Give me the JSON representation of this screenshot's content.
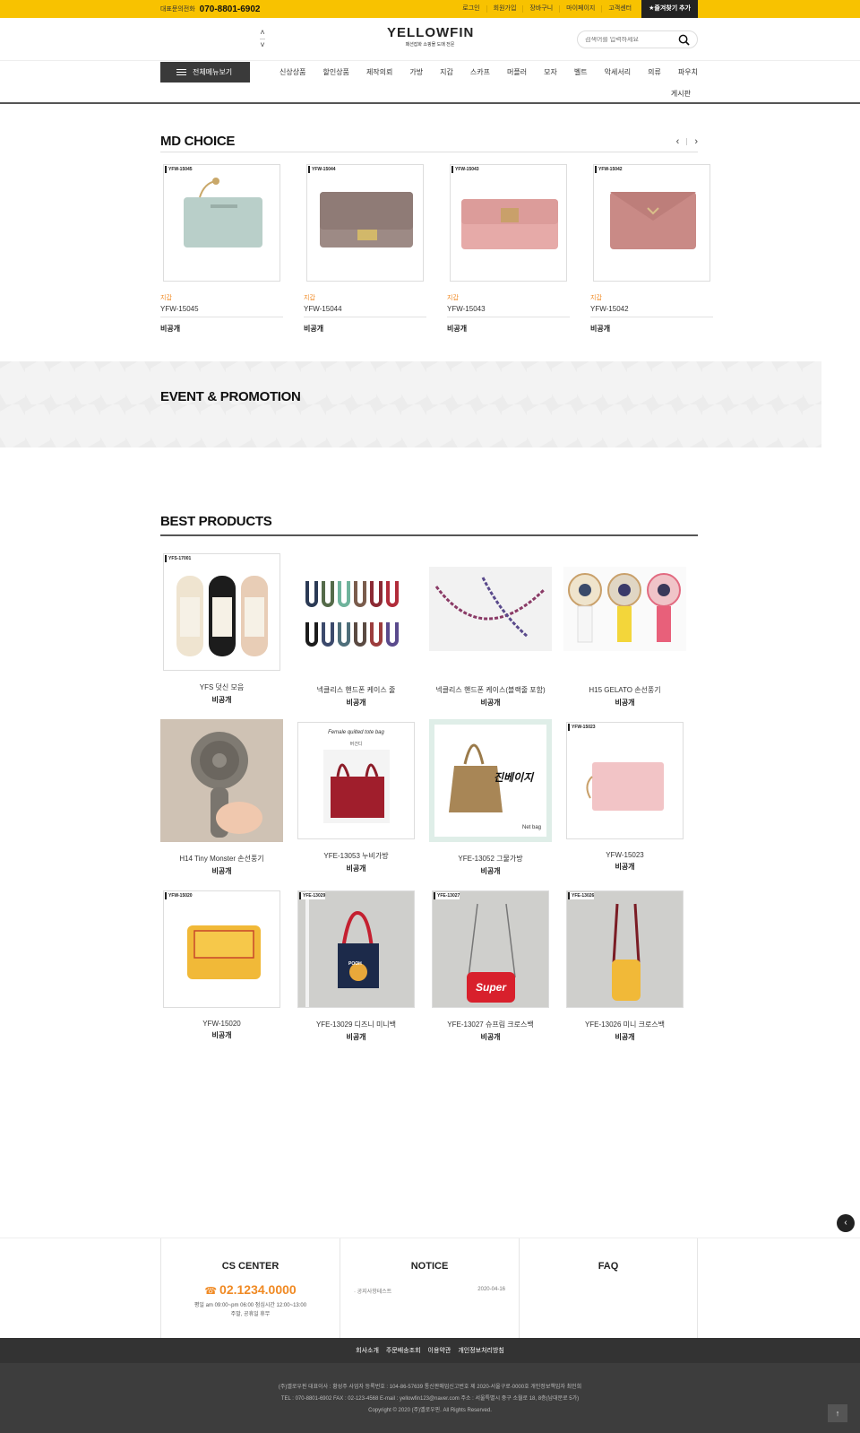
{
  "topbar": {
    "phone_label": "대표문의전화",
    "phone": "070-8801-6902",
    "links": [
      "로그인",
      "회원가입",
      "장바구니",
      "마이페이지",
      "고객센터"
    ],
    "favorite": "★즐겨찾기 추가"
  },
  "header": {
    "logo": "YELLOWFIN",
    "logo_sub": "패션잡화 쇼핑몰 도매 전문",
    "search_placeholder": "검색어를 입력하세요"
  },
  "nav": {
    "all_menu": "전체메뉴보기",
    "items": [
      "신상상품",
      "할인상품",
      "제작의뢰",
      "가방",
      "지갑",
      "스카프",
      "머플러",
      "모자",
      "벨트",
      "악세서리",
      "의류",
      "파우치"
    ],
    "board": "게시판"
  },
  "md_choice": {
    "title": "MD CHOICE",
    "items": [
      {
        "tag": "YFW-15045",
        "category": "지갑",
        "name": "YFW-15045",
        "price": "비공개",
        "color": "#b9cfc9"
      },
      {
        "tag": "YFW-15044",
        "category": "지갑",
        "name": "YFW-15044",
        "price": "비공개",
        "color": "#9d8a85"
      },
      {
        "tag": "YFW-15043",
        "category": "지갑",
        "name": "YFW-15043",
        "price": "비공개",
        "color": "#e6aaa8"
      },
      {
        "tag": "YFW-15042",
        "category": "지갑",
        "name": "YFW-15042",
        "price": "비공개",
        "color": "#c98a86"
      }
    ]
  },
  "event": {
    "title": "EVENT & PROMOTION"
  },
  "best": {
    "title": "BEST PRODUCTS",
    "items": [
      {
        "tag": "YFS-17001",
        "name": "YFS 덧신 모음",
        "price": "비공개"
      },
      {
        "tag": "",
        "name": "넥클리스 핸드폰 케이스 줄",
        "price": "비공개"
      },
      {
        "tag": "",
        "name": "넥클리스 핸드폰 케이스(블랙줄 포함)",
        "price": "비공개"
      },
      {
        "tag": "",
        "name": "H15 GELATO 손선풍기",
        "price": "비공개"
      },
      {
        "tag": "",
        "name": "H14 Tiny Monster 손선풍기",
        "price": "비공개"
      },
      {
        "tag": "",
        "name": "YFE-13053 누비가방",
        "price": "비공개",
        "img_text": "Female quilted tote bag",
        "img_sub": "버건디"
      },
      {
        "tag": "",
        "name": "YFE-13052 그물가방",
        "price": "비공개",
        "img_text": "진베이지",
        "img_sub": "Net bag"
      },
      {
        "tag": "YFW-15023",
        "name": "YFW-15023",
        "price": "비공개"
      },
      {
        "tag": "YFW-15020",
        "name": "YFW-15020",
        "price": "비공개"
      },
      {
        "tag": "YFE-13029",
        "name": "YFE-13029 디즈니 미니백",
        "price": "비공개",
        "img_text": "POOH"
      },
      {
        "tag": "YFE-13027",
        "name": "YFE-13027 슈프림 크로스백",
        "price": "비공개",
        "img_text": "Super"
      },
      {
        "tag": "YFE-13026",
        "name": "YFE-13026 미니 크로스백",
        "price": "비공개"
      }
    ]
  },
  "footer": {
    "cs_title": "CS CENTER",
    "cs_phone": "02.1234.0000",
    "cs_hours": "평일 am 09:00~pm 06:00 점심시간 12:00~13:00",
    "cs_hours2": "주말, 공휴일 휴무",
    "notice_title": "NOTICE",
    "notice_item": "· 공지사항테스트",
    "notice_date": "2020-04-16",
    "faq_title": "FAQ",
    "links": [
      "회사소개",
      "주문배송조회",
      "이용약관",
      "개인정보처리방침"
    ],
    "info1": "(주)옐로우핀   대표이사 : 황성주   사업자 등록번호 : 104-86-57639   통신판매업신고번호 제 2020-서울구로-0000호   개인정보책임자 최인희",
    "info2": "TEL : 070-8801-6902   FAX : 02-123-4568   E-mail : yellowfin123@naver.com   주소 : 서울특별시 중구 소월로 18, 8층(남대문로 5가)",
    "copyright": "Copyright © 2020 (주)옐로우핀. All Rights Reserved."
  }
}
